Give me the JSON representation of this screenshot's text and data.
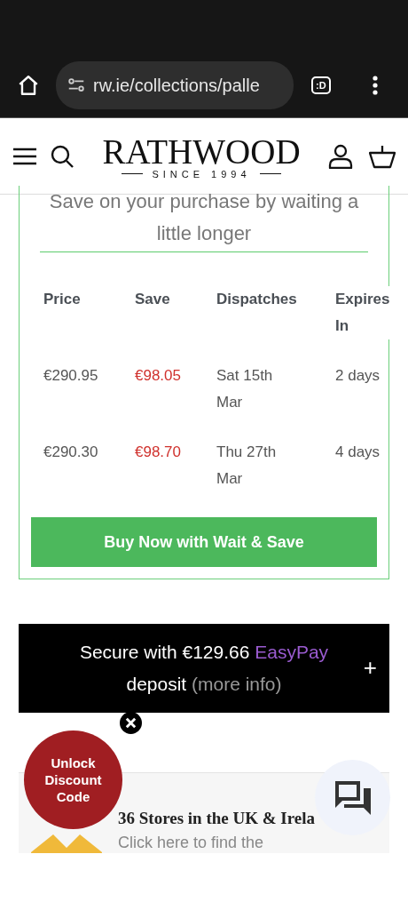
{
  "browser": {
    "url": "rw.ie/collections/palle",
    "tab_icon": ":D"
  },
  "header": {
    "logo": "RATHWOOD",
    "tagline": "SINCE 1994"
  },
  "wait_save": {
    "heading": "Save on your purchase by waiting a little longer",
    "columns": [
      "Price",
      "Save",
      "Dispatches",
      "Expires In"
    ],
    "rows": [
      {
        "price": "€290.95",
        "save": "€98.05",
        "dispatches": "Sat 15th Mar",
        "expires": "2 days"
      },
      {
        "price": "€290.30",
        "save": "€98.70",
        "dispatches": "Thu 27th Mar",
        "expires": "4 days"
      }
    ],
    "button": "Buy Now with Wait & Save"
  },
  "deposit": {
    "text": "Secure with €129.66",
    "brand": "EasyPay",
    "text_after": "deposit",
    "link": "(more info)",
    "expand": "+"
  },
  "promo": {
    "label": "Unlock Discount Code"
  },
  "stores": {
    "title": "36 Stores in the UK & Irela",
    "subtitle": "Click here to find the"
  }
}
